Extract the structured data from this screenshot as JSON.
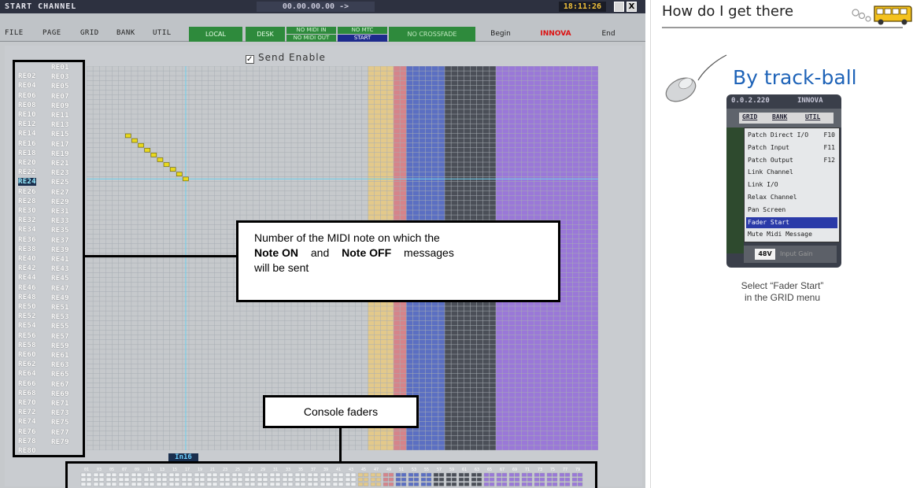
{
  "window": {
    "title": "START CHANNEL",
    "timecode": "00.00.00.00  ->",
    "clock": "18:11:26",
    "close_glyph": "X"
  },
  "menu": {
    "file": "FILE",
    "page": "PAGE",
    "grid": "GRID",
    "bank": "BANK",
    "util": "UTIL"
  },
  "toolbar": {
    "local": "LOCAL",
    "desk": "DESK",
    "no_midi_in": "NO MIDI IN",
    "no_mtc": "NO MTC",
    "no_midi_out": "NO MIDI OUT",
    "start": "START",
    "no_crossfade": "NO CROSSFADE",
    "begin": "Begin",
    "innova": "INNOVA",
    "end": "End"
  },
  "send_enable": {
    "label": "Send Enable",
    "checked": true,
    "check_glyph": "✓"
  },
  "re_labels": [
    "RE01",
    "RE02",
    "RE03",
    "RE04",
    "RE05",
    "RE06",
    "RE07",
    "RE08",
    "RE09",
    "RE10",
    "RE11",
    "RE12",
    "RE13",
    "RE14",
    "RE15",
    "RE16",
    "RE17",
    "RE18",
    "RE19",
    "RE20",
    "RE21",
    "RE22",
    "RE23",
    "RE24",
    "RE25",
    "RE26",
    "RE27",
    "RE28",
    "RE29",
    "RE30",
    "RE31",
    "RE32",
    "RE33",
    "RE34",
    "RE35",
    "RE36",
    "RE37",
    "RE38",
    "RE39",
    "RE40",
    "RE41",
    "RE42",
    "RE43",
    "RE44",
    "RE45",
    "RE46",
    "RE47",
    "RE48",
    "RE49",
    "RE50",
    "RE51",
    "RE52",
    "RE53",
    "RE54",
    "RE55",
    "RE56",
    "RE57",
    "RE58",
    "RE59",
    "RE60",
    "RE61",
    "RE62",
    "RE63",
    "RE64",
    "RE65",
    "RE66",
    "RE67",
    "RE68",
    "RE69",
    "RE70",
    "RE71",
    "RE72",
    "RE73",
    "RE74",
    "RE75",
    "RE76",
    "RE77",
    "RE78",
    "RE79",
    "RE80"
  ],
  "selected_re": "RE24",
  "input_label": "In16",
  "fader_numbers": [
    "01",
    "03",
    "05",
    "07",
    "09",
    "11",
    "13",
    "15",
    "17",
    "19",
    "21",
    "23",
    "25",
    "27",
    "29",
    "31",
    "33",
    "35",
    "37",
    "39",
    "41",
    "43",
    "45",
    "47",
    "49",
    "51",
    "53",
    "55",
    "57",
    "59",
    "61",
    "63",
    "65",
    "67",
    "69",
    "71",
    "73",
    "75",
    "77",
    "79"
  ],
  "callouts": {
    "note_line1": "Number of the MIDI note on which the",
    "note_bold1": "Note ON",
    "note_and": "and",
    "note_bold2": "Note OFF",
    "note_messages": "messages",
    "note_line3": "will be sent",
    "faders": "Console faders"
  },
  "help": {
    "title": "How do I get there",
    "subtitle": "By track-ball",
    "caption_line1": "Select “Fader Start”",
    "caption_line2": "in the GRID menu",
    "menu_shot": {
      "ip": "0.0.2.220",
      "brand": "INNOVA",
      "tabs": [
        "GRID",
        "BANK",
        "UTIL"
      ],
      "items": [
        {
          "label": "Patch Direct I/O",
          "key": "F10"
        },
        {
          "label": "Patch Input",
          "key": "F11"
        },
        {
          "label": "Patch Output",
          "key": "F12"
        },
        {
          "label": "Link Channel",
          "key": ""
        },
        {
          "label": "Link I/O",
          "key": ""
        },
        {
          "label": "Relax Channel",
          "key": ""
        },
        {
          "label": "Pan Screen",
          "key": ""
        },
        {
          "label": "Fader Start",
          "key": ""
        },
        {
          "label": "Mute Midi Message",
          "key": ""
        }
      ],
      "highlighted": "Fader Start",
      "bottom_label": "48V",
      "bottom_hint": "Input Gain"
    }
  },
  "colors": {
    "grid_bg": "#c6c9cc",
    "grid_line": "#a7adb3",
    "band_yellow": "#e3c98b",
    "band_red": "#d5848a",
    "band_blue": "#5b6fc2",
    "band_black": "#4b4f58",
    "band_purple": "#9a78d8",
    "cursor_line": "#6ed0ee",
    "diagonal": "#e8d81e"
  }
}
